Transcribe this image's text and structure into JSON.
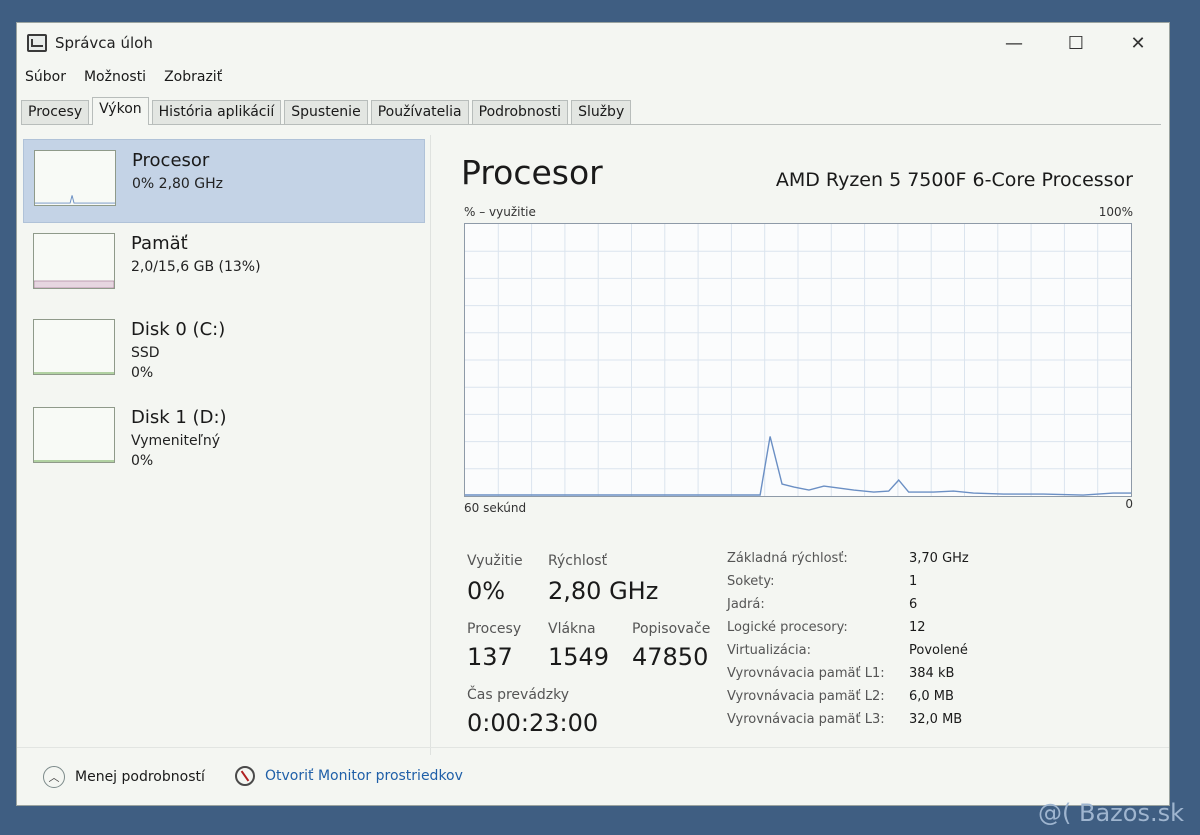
{
  "window": {
    "title": "Správca úloh",
    "buttons": {
      "minimize": "—",
      "maximize": "☐",
      "close": "✕"
    }
  },
  "menu": [
    "Súbor",
    "Možnosti",
    "Zobraziť"
  ],
  "tabs": [
    "Procesy",
    "Výkon",
    "História aplikácií",
    "Spustenie",
    "Používatelia",
    "Podrobnosti",
    "Služby"
  ],
  "active_tab": "Výkon",
  "sidebar": {
    "items": [
      {
        "name": "Procesor",
        "line1": "0%  2,80 GHz",
        "line2": ""
      },
      {
        "name": "Pamäť",
        "line1": "2,0/15,6 GB (13%)",
        "line2": ""
      },
      {
        "name": "Disk 0 (C:)",
        "line1": "SSD",
        "line2": "0%"
      },
      {
        "name": "Disk 1 (D:)",
        "line1": "Vymeniteľný",
        "line2": "0%"
      }
    ],
    "memory_usage_percent": 13
  },
  "main": {
    "title": "Procesor",
    "cpu_name": "AMD Ryzen 5 7500F 6-Core Processor",
    "graph": {
      "y_label": "% – využitie",
      "y_max_label": "100%",
      "x_label": "60 sekúnd",
      "y_min_label": "0",
      "colors": {
        "line": "#6b8fc4",
        "grid": "#dbe4ee",
        "border": "#8e9aa8"
      }
    },
    "stats": {
      "usage_label": "Využitie",
      "usage_value": "0%",
      "speed_label": "Rýchlosť",
      "speed_value": "2,80 GHz",
      "processes_label": "Procesy",
      "processes_value": "137",
      "threads_label": "Vlákna",
      "threads_value": "1549",
      "handles_label": "Popisovače",
      "handles_value": "47850",
      "uptime_label": "Čas prevádzky",
      "uptime_value": "0:00:23:00"
    },
    "specs": [
      {
        "key": "Základná rýchlosť:",
        "value": "3,70 GHz"
      },
      {
        "key": "Sokety:",
        "value": "1"
      },
      {
        "key": "Jadrá:",
        "value": "6"
      },
      {
        "key": "Logické procesory:",
        "value": "12"
      },
      {
        "key": "Virtualizácia:",
        "value": "Povolené"
      },
      {
        "key": "Vyrovnávacia pamäť L1:",
        "value": "384 kB"
      },
      {
        "key": "Vyrovnávacia pamäť L2:",
        "value": "6,0 MB"
      },
      {
        "key": "Vyrovnávacia pamäť L3:",
        "value": "32,0 MB"
      }
    ]
  },
  "footer": {
    "less_details": "Menej podrobností",
    "open_monitor": "Otvoriť Monitor prostriedkov"
  },
  "watermark": "@( Bazos.sk"
}
